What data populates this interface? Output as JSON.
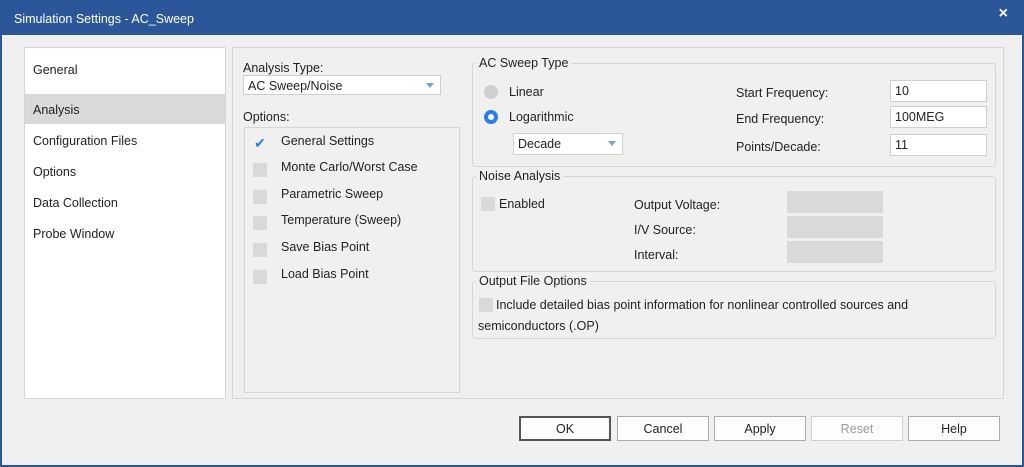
{
  "window": {
    "title": "Simulation Settings - AC_Sweep",
    "close_glyph": "×"
  },
  "nav": {
    "items": [
      "General",
      "Analysis",
      "Configuration Files",
      "Options",
      "Data Collection",
      "Probe Window"
    ],
    "selected": "Analysis"
  },
  "analysis": {
    "type_label": "Analysis Type:",
    "type_value": "AC Sweep/Noise",
    "options_label": "Options:",
    "options": [
      {
        "label": "General Settings",
        "checked": true
      },
      {
        "label": "Monte Carlo/Worst Case",
        "checked": false
      },
      {
        "label": "Parametric Sweep",
        "checked": false
      },
      {
        "label": "Temperature (Sweep)",
        "checked": false
      },
      {
        "label": "Save Bias Point",
        "checked": false
      },
      {
        "label": "Load Bias Point",
        "checked": false
      }
    ]
  },
  "ac_sweep": {
    "legend": "AC Sweep Type",
    "linear_label": "Linear",
    "log_label": "Logarithmic",
    "selected": "Logarithmic",
    "log_unit": "Decade",
    "start_label": "Start Frequency:",
    "start_value": "10",
    "end_label": "End Frequency:",
    "end_value": "100MEG",
    "points_label": "Points/Decade:",
    "points_value": "11"
  },
  "noise": {
    "legend": "Noise Analysis",
    "enabled_label": "Enabled",
    "enabled": false,
    "output_voltage_label": "Output Voltage:",
    "iv_source_label": "I/V Source:",
    "interval_label": "Interval:"
  },
  "output_file": {
    "legend": "Output File Options",
    "line1": "Include detailed bias point information for nonlinear controlled sources and",
    "line2": "semiconductors (.OP)",
    "checked": false
  },
  "buttons": {
    "ok": "OK",
    "cancel": "Cancel",
    "apply": "Apply",
    "reset": "Reset",
    "help": "Help"
  }
}
